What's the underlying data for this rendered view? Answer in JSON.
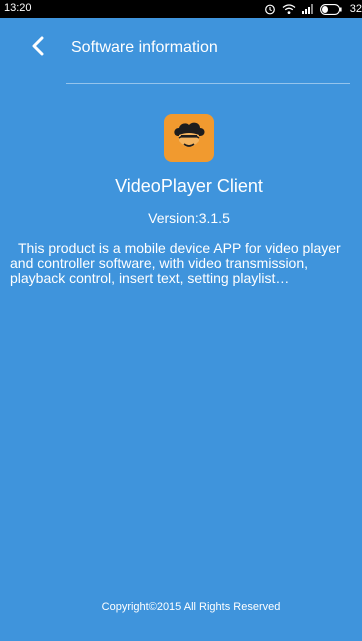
{
  "status_bar": {
    "time": "13:20",
    "battery_percent": "32",
    "icons": [
      "alarm-icon",
      "wifi-icon",
      "signal-icon",
      "battery-icon"
    ]
  },
  "header": {
    "back_icon": "chevron-left-icon",
    "title": "Software information"
  },
  "app": {
    "icon": "cloud-face-logo",
    "name": "VideoPlayer Client",
    "version": "Version:3.1.5",
    "description": "This product is a mobile device APP for video player and controller software, with video transmission, playback control, insert text, setting playlist…"
  },
  "footer": {
    "copyright": "Copyright©2015 All Rights Reserved"
  },
  "colors": {
    "background": "#3f94dc",
    "icon_background": "#f19a2f",
    "status_bar": "#000000"
  }
}
